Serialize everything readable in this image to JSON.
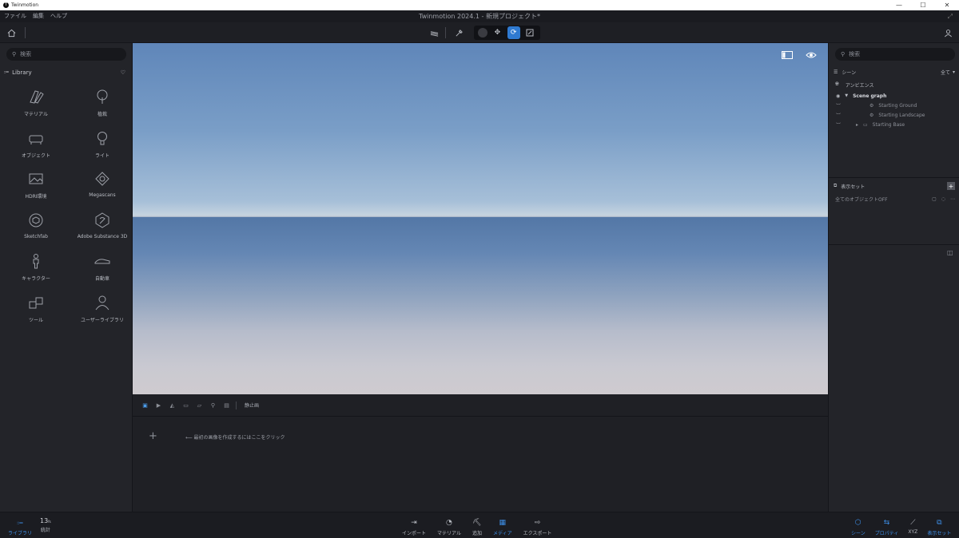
{
  "window": {
    "app_name": "Twinmotion",
    "controls": [
      "—",
      "☐",
      "✕"
    ]
  },
  "menubar": {
    "items": [
      "ファイル",
      "編集",
      "ヘルプ"
    ],
    "project_title": "Twinmotion 2024.1 - 新規プロジェクト*"
  },
  "left_panel": {
    "search_placeholder": "検索",
    "library_label": "Library",
    "items": [
      {
        "label": "マテリアル",
        "icon": "material-swatch-icon"
      },
      {
        "label": "植栽",
        "icon": "tree-icon"
      },
      {
        "label": "オブジェクト",
        "icon": "sofa-icon"
      },
      {
        "label": "ライト",
        "icon": "lightbulb-icon"
      },
      {
        "label": "HDRI環境",
        "icon": "hdri-image-icon"
      },
      {
        "label": "Megascans",
        "icon": "megascans-icon"
      },
      {
        "label": "Sketchfab",
        "icon": "sketchfab-icon"
      },
      {
        "label": "Adobe Substance 3D",
        "icon": "substance-icon"
      },
      {
        "label": "キャラクター",
        "icon": "person-icon"
      },
      {
        "label": "自動車",
        "icon": "car-icon"
      },
      {
        "label": "ツール",
        "icon": "cubes-icon"
      },
      {
        "label": "ユーザーライブラリ",
        "icon": "user-library-icon"
      }
    ]
  },
  "sequence_bar": {
    "label": "静止画"
  },
  "media_area": {
    "hint": "最初の画像を作成するにはここをクリック"
  },
  "right_panel": {
    "search_placeholder": "検索",
    "scene_label": "シーン",
    "filter_label": "全て",
    "ambience_label": "アンビエンス",
    "scene_graph_label": "Scene graph",
    "tree": [
      "Starting Ground",
      "Starting Landscape",
      "Starting Base"
    ],
    "display_set_label": "表示セット",
    "display_set_item": "全てのオブジェクトOFF"
  },
  "bottom_bar": {
    "library": "ライブラリ",
    "stats_value": "13",
    "stats_unit": "fs",
    "stats_label": "統計",
    "center": [
      "インポート",
      "マテリアル",
      "追加",
      "メディア",
      "エクスポート"
    ],
    "right": [
      "シーン",
      "プロパティ",
      "XYZ",
      "表示セット"
    ]
  },
  "colors": {
    "accent": "#2f7ad1",
    "panel": "#232429",
    "background": "#1e1f24"
  }
}
